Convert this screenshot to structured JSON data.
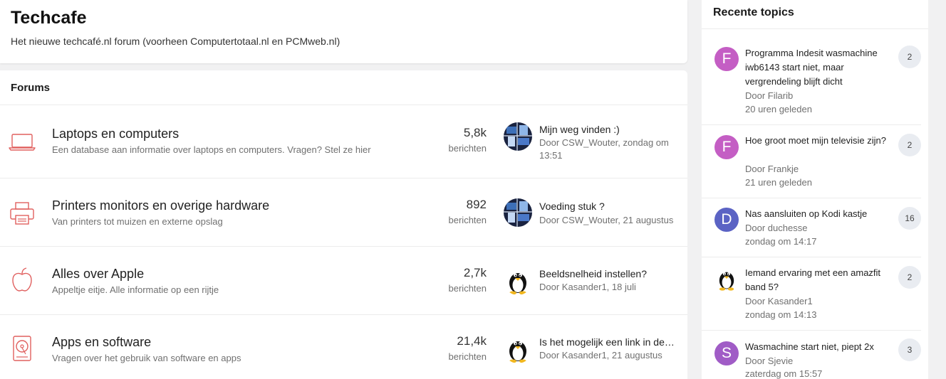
{
  "site": {
    "title": "Techcafe",
    "description": "Het nieuwe techcafé.nl forum (voorheen Computertotaal.nl en PCMweb.nl)"
  },
  "forums": {
    "heading": "Forums",
    "items": [
      {
        "icon": "laptop-icon",
        "name": "Laptops en computers",
        "description": "Een database aan informatie over laptops en computers. Vragen? Stel ze hier",
        "count": "5,8k",
        "count_label": "berichten",
        "last_title": "Mijn weg vinden :)",
        "last_meta": "Door CSW_Wouter, zondag om 13:51",
        "last_avatar": "circuit-avatar"
      },
      {
        "icon": "printer-icon",
        "name": "Printers monitors en overige hardware",
        "description": "Van printers tot muizen en externe opslag",
        "count": "892",
        "count_label": "berichten",
        "last_title": "Voeding stuk ?",
        "last_meta": "Door CSW_Wouter, 21 augustus",
        "last_avatar": "circuit-avatar"
      },
      {
        "icon": "apple-icon",
        "name": "Alles over Apple",
        "description": "Appeltje eitje. Alle informatie op een rijtje",
        "count": "2,7k",
        "count_label": "berichten",
        "last_title": "Beeldsnelheid instellen?",
        "last_meta": "Door Kasander1, 18 juli",
        "last_avatar": "penguin-avatar"
      },
      {
        "icon": "hard-drive-icon",
        "name": "Apps en software",
        "description": "Vragen over het gebruik van software en apps",
        "count": "21,4k",
        "count_label": "berichten",
        "last_title": "Is het mogelijk een link in deze app te plaatsen",
        "last_meta": "Door Kasander1, 21 augustus",
        "last_avatar": "penguin-avatar"
      }
    ]
  },
  "sidebar": {
    "heading": "Recente topics",
    "topics": [
      {
        "avatar_letter": "F",
        "avatar_color": "#c45ec4",
        "title": "Programma Indesit wasmachine iwb6143 start niet, maar vergrendeling blijft dicht",
        "author": "Door Filarib",
        "time": "20 uren geleden",
        "replies": "2"
      },
      {
        "avatar_letter": "F",
        "avatar_color": "#c45ec4",
        "title": "Hoe groot moet mijn televisie zijn?",
        "author": "Door Frankje",
        "time": "21 uren geleden",
        "replies": "2"
      },
      {
        "avatar_letter": "D",
        "avatar_color": "#5b63c4",
        "title": "Nas aansluiten op Kodi kastje",
        "author": "Door duchesse",
        "time": "zondag om 14:17",
        "replies": "16"
      },
      {
        "avatar_letter": "",
        "avatar_color": "",
        "title": "Iemand ervaring met een amazfit band 5?",
        "author": "Door Kasander1",
        "time": "zondag om 14:13",
        "replies": "2"
      },
      {
        "avatar_letter": "S",
        "avatar_color": "#a05cc6",
        "title": "Wasmachine start niet, piept 2x",
        "author": "Door Sjevie",
        "time": "zaterdag om 15:57",
        "replies": "3"
      }
    ]
  },
  "colors": {
    "accent": "#e0605f"
  }
}
